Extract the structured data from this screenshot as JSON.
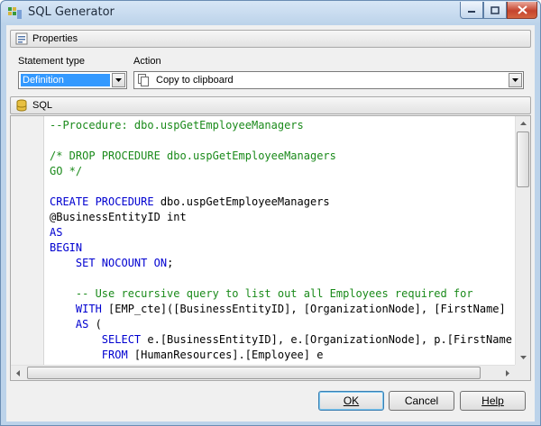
{
  "window": {
    "title": "SQL Generator"
  },
  "properties": {
    "header": "Properties",
    "statement_type": {
      "label": "Statement type",
      "value": "Definition"
    },
    "action": {
      "label": "Action",
      "value": "Copy to clipboard"
    }
  },
  "sql": {
    "header": "SQL",
    "lines": [
      [
        {
          "t": "--Procedure: dbo.uspGetEmployeeManagers",
          "c": "green"
        }
      ],
      [],
      [
        {
          "t": "/* DROP PROCEDURE dbo.uspGetEmployeeManagers",
          "c": "green"
        }
      ],
      [
        {
          "t": "GO */",
          "c": "green"
        }
      ],
      [],
      [
        {
          "t": "CREATE PROCEDURE",
          "c": "blue"
        },
        {
          "t": " dbo.uspGetEmployeeManagers",
          "c": "black"
        }
      ],
      [
        {
          "t": "@BusinessEntityID int",
          "c": "black"
        }
      ],
      [
        {
          "t": "AS",
          "c": "blue"
        }
      ],
      [
        {
          "t": "BEGIN",
          "c": "blue"
        }
      ],
      [
        {
          "t": "    ",
          "c": "black"
        },
        {
          "t": "SET NOCOUNT ON",
          "c": "blue"
        },
        {
          "t": ";",
          "c": "black"
        }
      ],
      [],
      [
        {
          "t": "    -- Use recursive query to list out all Employees required for",
          "c": "green"
        }
      ],
      [
        {
          "t": "    ",
          "c": "black"
        },
        {
          "t": "WITH",
          "c": "blue"
        },
        {
          "t": " [EMP_cte]([BusinessEntityID], [OrganizationNode], [FirstName]",
          "c": "black"
        }
      ],
      [
        {
          "t": "    ",
          "c": "black"
        },
        {
          "t": "AS",
          "c": "blue"
        },
        {
          "t": " (",
          "c": "black"
        }
      ],
      [
        {
          "t": "        ",
          "c": "black"
        },
        {
          "t": "SELECT",
          "c": "blue"
        },
        {
          "t": " e.[BusinessEntityID], e.[OrganizationNode], p.[FirstName]",
          "c": "black"
        }
      ],
      [
        {
          "t": "        ",
          "c": "black"
        },
        {
          "t": "FROM",
          "c": "blue"
        },
        {
          "t": " [HumanResources].[Employee] e",
          "c": "black"
        }
      ]
    ]
  },
  "buttons": {
    "ok": "OK",
    "cancel": "Cancel",
    "help": "Help"
  },
  "colors": {
    "keyword": "#0000d0",
    "comment": "#1a8a1a",
    "selection": "#3399ff"
  }
}
